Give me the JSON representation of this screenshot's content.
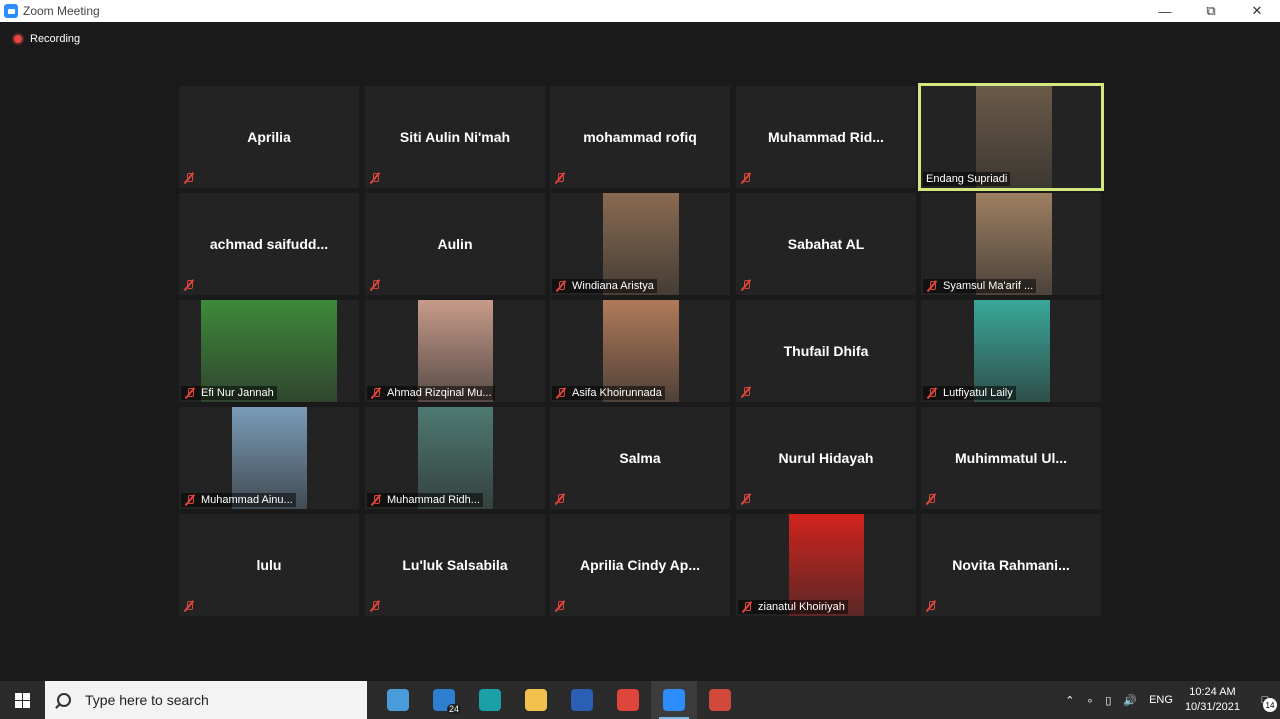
{
  "window": {
    "title": "Zoom Meeting"
  },
  "recording": {
    "label": "Recording"
  },
  "participants": [
    {
      "name": "Aprilia"
    },
    {
      "name": "Siti Aulin Ni'mah"
    },
    {
      "name": "mohammad rofiq"
    },
    {
      "name": "Muhammad  Rid..."
    },
    {
      "name": "Endang Supriadi",
      "video": true,
      "active_speaker": true,
      "video_color": "#6b5a48"
    },
    {
      "name": "achmad  saifudd..."
    },
    {
      "name": "Aulin"
    },
    {
      "name": "Windiana Aristya",
      "video": true,
      "video_color": "#8a6b52"
    },
    {
      "name": "Sabahat AL"
    },
    {
      "name": "Syamsul Ma'arif ...",
      "video": true,
      "video_color": "#9e7f62"
    },
    {
      "name": "Efi Nur Jannah",
      "video": true,
      "video_color": "#3d8a3a"
    },
    {
      "name": "Ahmad Rizqinal Mu...",
      "video": true,
      "video_color": "#c79b8a"
    },
    {
      "name": "Asifa Khoirunnada",
      "video": true,
      "video_color": "#b07a5a"
    },
    {
      "name": "Thufail Dhifa"
    },
    {
      "name": "Lutfiyatul Laily",
      "video": true,
      "video_color": "#3aa89a"
    },
    {
      "name": "Muhammad Ainu...",
      "video": true,
      "video_color": "#7a9cb8"
    },
    {
      "name": "Muhammad Ridh...",
      "video": true,
      "video_color": "#4e7a72"
    },
    {
      "name": "Salma"
    },
    {
      "name": "Nurul Hidayah"
    },
    {
      "name": "Muhimmatul  Ul..."
    },
    {
      "name": "lulu"
    },
    {
      "name": "Lu'luk Salsabila"
    },
    {
      "name": "Aprilia  Cindy  Ap..."
    },
    {
      "name": "zianatul Khoiriyah",
      "video": true,
      "video_color": "#d2231c"
    },
    {
      "name": "Novita  Rahmani..."
    }
  ],
  "taskbar": {
    "search_placeholder": "Type here to search",
    "apps": [
      {
        "icon": "people-app-icon",
        "color": "#4a9bd9"
      },
      {
        "icon": "mail-icon",
        "color": "#2f7fd1",
        "badge": "24"
      },
      {
        "icon": "edge-browser-icon",
        "color": "#1ba0a8"
      },
      {
        "icon": "file-explorer-icon",
        "color": "#f2c14e"
      },
      {
        "icon": "word-icon",
        "color": "#2b5fb4"
      },
      {
        "icon": "chrome-icon",
        "color": "#e0453c"
      },
      {
        "icon": "zoom-icon",
        "color": "#2d8cff",
        "active": true
      },
      {
        "icon": "app-icon",
        "color": "#d04a3a"
      }
    ],
    "language": "ENG",
    "time": "10:24 AM",
    "date": "10/31/2021",
    "notification_count": "14"
  }
}
